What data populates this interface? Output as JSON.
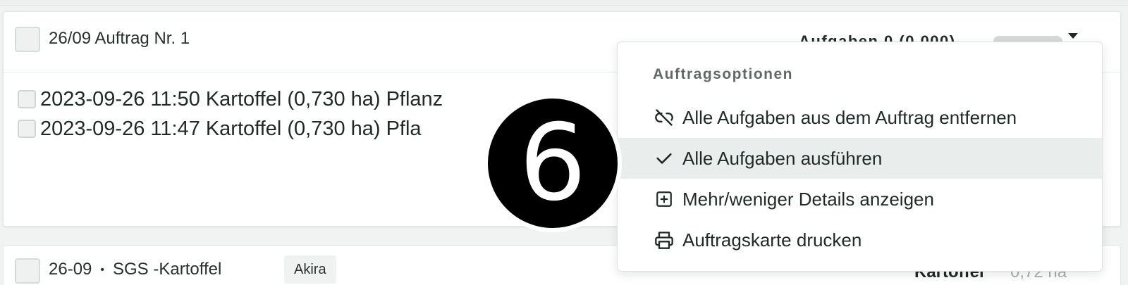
{
  "order_card": {
    "title": "26/09 Auftrag Nr. 1",
    "tasks_summary": "Aufgaben 0 (0,000)",
    "tasks": [
      {
        "date": "2023-09-26 11:50",
        "crop": "Kartoffel (0,730 ha)",
        "type": "Pflanz"
      },
      {
        "date": "2023-09-26 11:47",
        "crop": "Kartoffel (0,730 ha)",
        "type": "Pfla"
      }
    ]
  },
  "second_card": {
    "date": "26-09",
    "separator": "•",
    "name": "SGS -Kartoffel",
    "user_tag": "Akira",
    "crop": "Kartoffel",
    "area": "0,72 ha"
  },
  "dropdown": {
    "header": "Auftragsoptionen",
    "items": [
      {
        "label": "Alle Aufgaben aus dem Auftrag entfernen",
        "icon": "unlink-icon"
      },
      {
        "label": "Alle Aufgaben ausführen",
        "icon": "check-icon"
      },
      {
        "label": "Mehr/weniger Details anzeigen",
        "icon": "plus-square-icon"
      },
      {
        "label": "Auftragskarte drucken",
        "icon": "printer-icon"
      }
    ]
  },
  "step_badge": "6",
  "colors": {
    "background": "#f1f3f2",
    "card": "#ffffff",
    "active_item": "#e9eeec",
    "text": "#1f2a28",
    "muted": "#5f6a67",
    "progress_track": "#d7d9d8"
  }
}
